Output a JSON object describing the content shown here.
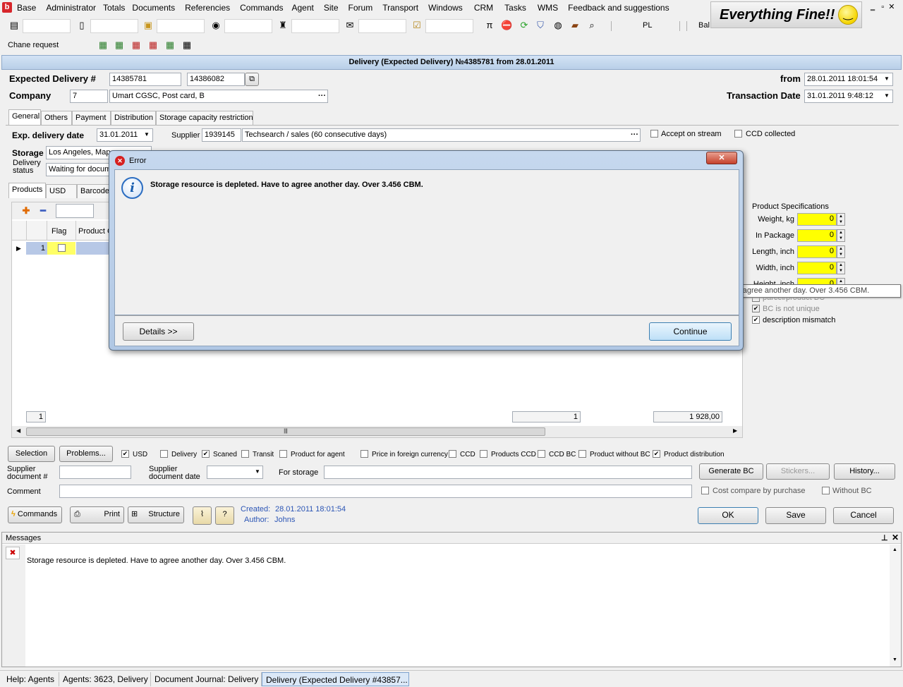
{
  "menu": [
    "Base",
    "Administrator",
    "Totals",
    "Documents",
    "Referencies",
    "Commands",
    "Agent",
    "Site",
    "Forum",
    "Transport",
    "Windows",
    "CRM",
    "Tasks",
    "WMS",
    "Feedback and suggestions"
  ],
  "banner": "Everything Fine!!",
  "toolbar": {
    "lang": "PL",
    "balance_label": "Balance:"
  },
  "subbar": {
    "label": "Chane request"
  },
  "window_title": "Delivery (Expected Delivery) №4385781 from 28.01.2011",
  "header": {
    "expected_delivery_label": "Expected Delivery #",
    "expected_delivery_1": "14385781",
    "expected_delivery_2": "14386082",
    "company_label": "Company",
    "company_code": "7",
    "company_name": "Umart CGSC, Post card, B",
    "from_label": "from",
    "from_value": "28.01.2011 18:01:54",
    "transaction_label": "Transaction Date",
    "transaction_value": "31.01.2011 9:48:12"
  },
  "tabs": [
    "General",
    "Others",
    "Payment",
    "Distribution",
    "Storage capacity restriction"
  ],
  "general": {
    "exp_delivery_label": "Exp. delivery date",
    "exp_delivery_value": "31.01.2011",
    "supplier_label": "Supplier",
    "supplier_code": "1939145",
    "supplier_name": "Techsearch / sales (60 consecutive days)",
    "accept_on_stream": "Accept on stream",
    "ccd_collected": "CCD collected",
    "storage_label": "Storage",
    "storage_value": "Los Angeles, Map",
    "delivery_status_label": "Delivery\nstatus",
    "delivery_status_value": "Waiting for docum"
  },
  "subtabs": [
    "Products",
    "USD",
    "Barcodes"
  ],
  "grid": {
    "col_flag": "Flag",
    "col_product": "Product C",
    "row_num": "1",
    "footer_count": "1",
    "footer_qty": "1",
    "footer_sum": "1 928,00"
  },
  "specs": {
    "title": "Product Specifications",
    "rows": [
      {
        "label": "Weight, kg",
        "value": "0"
      },
      {
        "label": "In Package",
        "value": "0"
      },
      {
        "label": "Length, inch",
        "value": "0"
      },
      {
        "label": "Width, inch",
        "value": "0"
      },
      {
        "label": "Height, inch",
        "value": "0"
      }
    ],
    "parcel_label": "parcel/product BC",
    "bc_not_unique": "BC is not unique",
    "description_mismatch": "description mismatch"
  },
  "tooltip": "Storage resource is depleted. Have to agree another day. Over 3.456 CBM.",
  "dialog": {
    "title": "Error",
    "message": "Storage resource is depleted. Have to agree another day. Over 3.456 CBM.",
    "details_button": "Details >>",
    "continue_button": "Continue"
  },
  "filters": {
    "selection": "Selection",
    "problems": "Problems...",
    "checks": [
      {
        "label": "USD",
        "checked": true
      },
      {
        "label": "Delivery",
        "checked": false
      },
      {
        "label": "Scaned",
        "checked": true
      },
      {
        "label": "Transit",
        "checked": false
      },
      {
        "label": "Product for agent",
        "checked": false
      },
      {
        "label": "Price in foreign currency",
        "checked": false
      },
      {
        "label": "CCD",
        "checked": false
      },
      {
        "label": "Products CCD",
        "checked": false
      },
      {
        "label": "CCD BC",
        "checked": false
      },
      {
        "label": "Product without BC",
        "checked": false
      },
      {
        "label": "Product distribution",
        "checked": true
      }
    ]
  },
  "bottom": {
    "supplier_doc_label": "Supplier\ndocument #",
    "supplier_doc_date_label": "Supplier\ndocument date",
    "for_storage_label": "For storage",
    "generate_bc": "Generate BC",
    "stickers": "Stickers...",
    "history": "History...",
    "comment_label": "Comment",
    "cost_compare": "Cost compare by purchase",
    "without_bc": "Without BC",
    "commands": "Commands",
    "print": "Print",
    "structure": "Structure",
    "help_btn": "?",
    "created_label": "Created:",
    "created_value": "28.01.2011 18:01:54",
    "author_label": "Author:",
    "author_value": "Johns",
    "ok": "OK",
    "save": "Save",
    "cancel": "Cancel"
  },
  "messages": {
    "title": "Messages",
    "text": "Storage resource is depleted. Have to agree another day. Over 3.456 CBM."
  },
  "statusbar": [
    "Help: Agents",
    "Agents: 3623, Delivery",
    "Document Journal: Delivery",
    "Delivery (Expected Delivery #43857..."
  ]
}
